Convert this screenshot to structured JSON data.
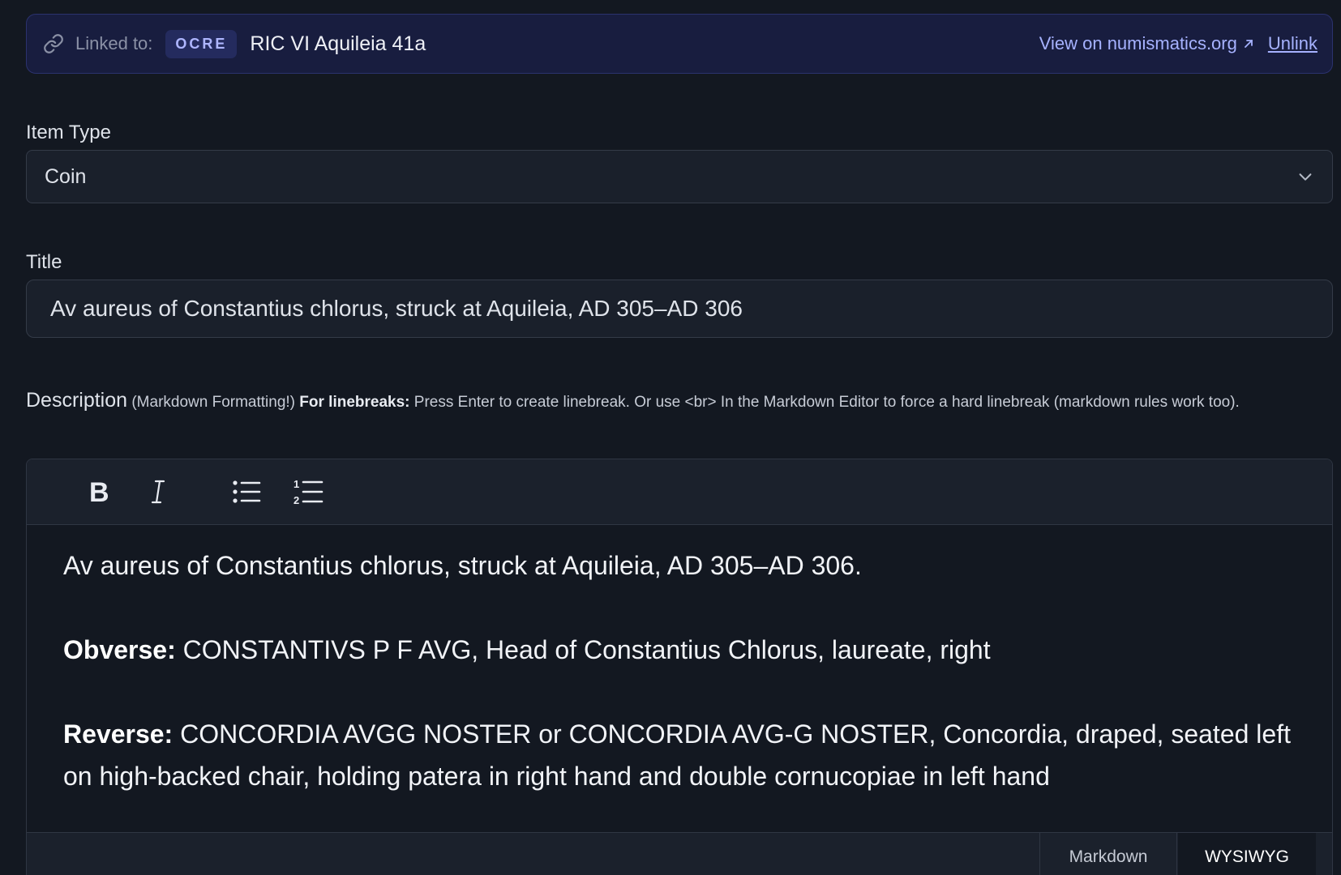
{
  "link_banner": {
    "linked_label": "Linked to:",
    "badge": "OCRE",
    "reference": "RIC VI Aquileia 41a",
    "view_link": "View on numismatics.org",
    "unlink": "Unlink",
    "icons": [
      "link-icon",
      "external-arrow-icon"
    ]
  },
  "item_type": {
    "label": "Item Type",
    "value": "Coin"
  },
  "title": {
    "label": "Title",
    "value": "Av aureus of Constantius chlorus, struck at Aquileia, AD 305–AD 306"
  },
  "description": {
    "label": "Description",
    "hint_prefix": "(Markdown Formatting!)",
    "hint_bold": "For linebreaks:",
    "hint_text": "Press Enter to create linebreak. Or use <br> In the Markdown Editor to force a hard linebreak (markdown rules work too).",
    "toolbar": [
      "bold",
      "italic",
      "bulleted-list",
      "numbered-list"
    ],
    "content": {
      "intro": "Av aureus of Constantius chlorus, struck at Aquileia, AD 305–AD 306.",
      "obverse_label": "Obverse:",
      "obverse_text": "CONSTANTIVS P F AVG, Head of Constantius Chlorus, laureate, right",
      "reverse_label": "Reverse:",
      "reverse_text": "CONCORDIA AVGG NOSTER or CONCORDIA AVG-G NOSTER, Concordia, draped, seated left on high-backed chair, holding patera in right hand and double cornucopiae in left hand"
    },
    "modes": {
      "markdown": "Markdown",
      "wysiwyg": "WYSIWYG",
      "active": "WYSIWYG"
    }
  },
  "colors": {
    "background": "#131821",
    "banner_bg": "#181d3f",
    "accent_link": "#a6b2ff"
  }
}
